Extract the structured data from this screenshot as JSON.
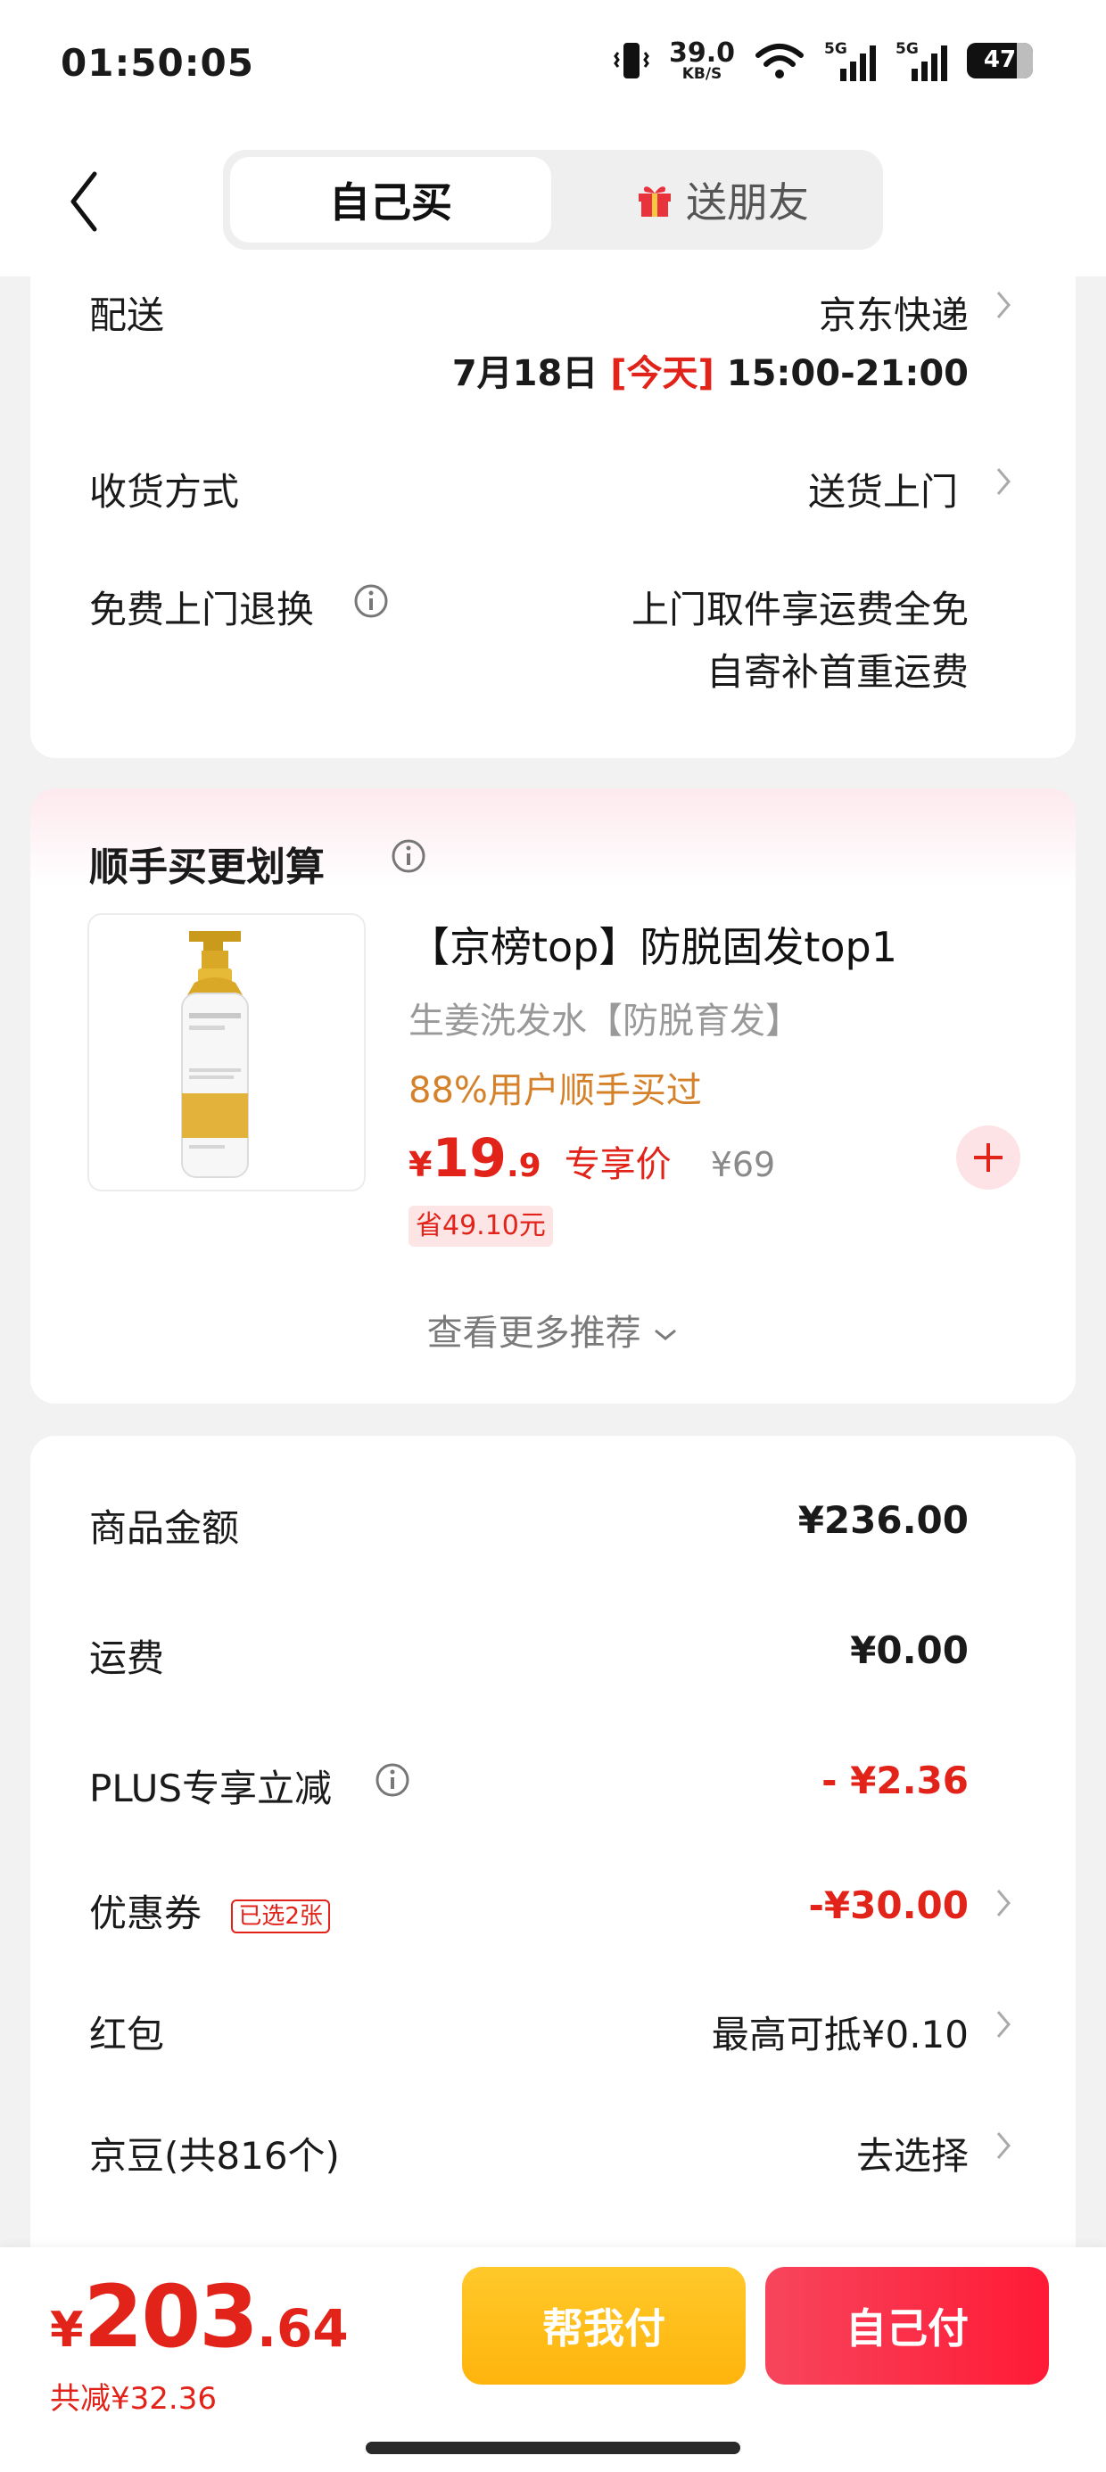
{
  "status_bar": {
    "time": "01:50:05",
    "net_speed_value": "39.0",
    "net_speed_unit": "KB/S",
    "signal1_label": "5G",
    "signal2_label": "5G",
    "battery": "47"
  },
  "header": {
    "tab_self": "自己买",
    "tab_gift": "送朋友",
    "icons": [
      "back-arrow-icon",
      "gift-icon"
    ]
  },
  "delivery": {
    "label": "配送",
    "carrier": "京东快递",
    "date": "7月18日",
    "today_tag": "[今天]",
    "time_window": "15:00-21:00",
    "receive_label": "收货方式",
    "receive_value": "送货上门",
    "return_label": "免费上门退换",
    "return_line1": "上门取件享运费全免",
    "return_line2": "自寄补首重运费"
  },
  "recommend": {
    "title": "顺手买更划算",
    "product_title": "【京榜top】防脱固发top1",
    "product_subtitle": "生姜洗发水【防脱育发】",
    "buy_rate": "88%用户顺手买过",
    "price_currency": "¥",
    "price_int": "19",
    "price_dec": ".9",
    "price_tag": "专享价",
    "original_price": "¥69",
    "save_tag": "省49.10元",
    "more_label": "查看更多推荐"
  },
  "summary": {
    "goods_amount_label": "商品金额",
    "goods_amount": "¥236.00",
    "shipping_label": "运费",
    "shipping": "¥0.00",
    "plus_label": "PLUS专享立减",
    "plus_discount": "- ¥2.36",
    "coupon_label": "优惠券",
    "coupon_badge": "已选2张",
    "coupon_value": "-¥30.00",
    "hongbao_label": "红包",
    "hongbao_value": "最高可抵¥0.10",
    "jingdou_label": "京豆(共816个)",
    "jingdou_value": "去选择"
  },
  "bottom": {
    "currency": "¥",
    "total_int": "203",
    "total_dec": ".64",
    "saved": "共减¥32.36",
    "help_pay": "帮我付",
    "self_pay": "自己付"
  },
  "colors": {
    "accent_red": "#e2231a",
    "orange": "#d4812a",
    "help_yellow": "#ffc92a",
    "pay_red": "#ff1a36"
  }
}
